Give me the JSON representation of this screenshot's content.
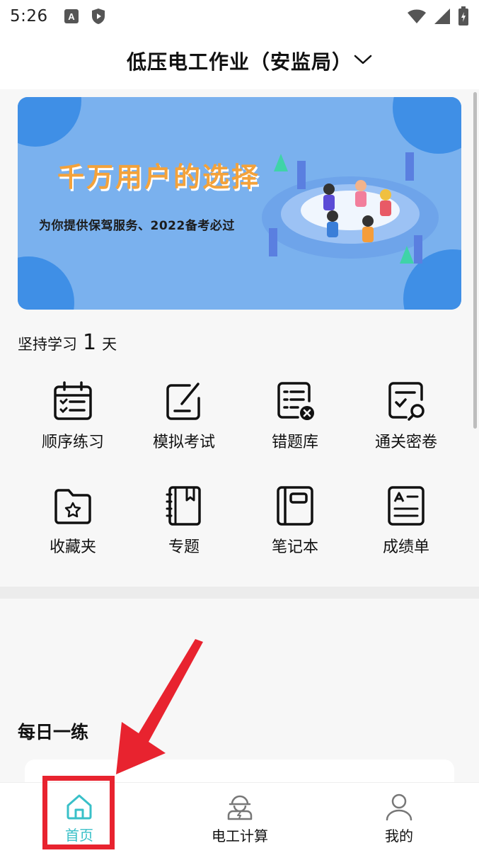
{
  "status_bar": {
    "time": "5:26",
    "left_icons": [
      "font-accessibility-icon",
      "play-protect-icon"
    ],
    "right_icons": [
      "wifi-icon",
      "cell-signal-icon",
      "battery-icon"
    ]
  },
  "header": {
    "title": "低压电工作业（安监局）",
    "dropdown_icon": "chevron-down-icon"
  },
  "banner": {
    "headline": "千万用户的选择",
    "subtitle": "为你提供保驾服务、2022备考必过"
  },
  "streak": {
    "prefix": "坚持学习",
    "days": "1",
    "suffix": "天"
  },
  "features": [
    {
      "label": "顺序练习",
      "icon": "calendar-checklist-icon"
    },
    {
      "label": "模拟考试",
      "icon": "edit-note-icon"
    },
    {
      "label": "错题库",
      "icon": "error-list-icon"
    },
    {
      "label": "通关密卷",
      "icon": "exam-paper-icon"
    },
    {
      "label": "收藏夹",
      "icon": "star-folder-icon"
    },
    {
      "label": "专题",
      "icon": "notebook-bookmark-icon"
    },
    {
      "label": "笔记本",
      "icon": "notebook-icon"
    },
    {
      "label": "成绩单",
      "icon": "report-card-icon"
    }
  ],
  "daily": {
    "title": "每日一练"
  },
  "tabbar": {
    "tabs": [
      {
        "label": "首页",
        "icon": "home-icon",
        "active": true
      },
      {
        "label": "电工计算",
        "icon": "electrician-icon",
        "active": false
      },
      {
        "label": "我的",
        "icon": "user-icon",
        "active": false
      }
    ]
  },
  "colors": {
    "accent": "#39c0c8",
    "highlight": "#e8232f",
    "banner_bg": "#7ab1ee",
    "banner_headline": "#f3a23b"
  }
}
